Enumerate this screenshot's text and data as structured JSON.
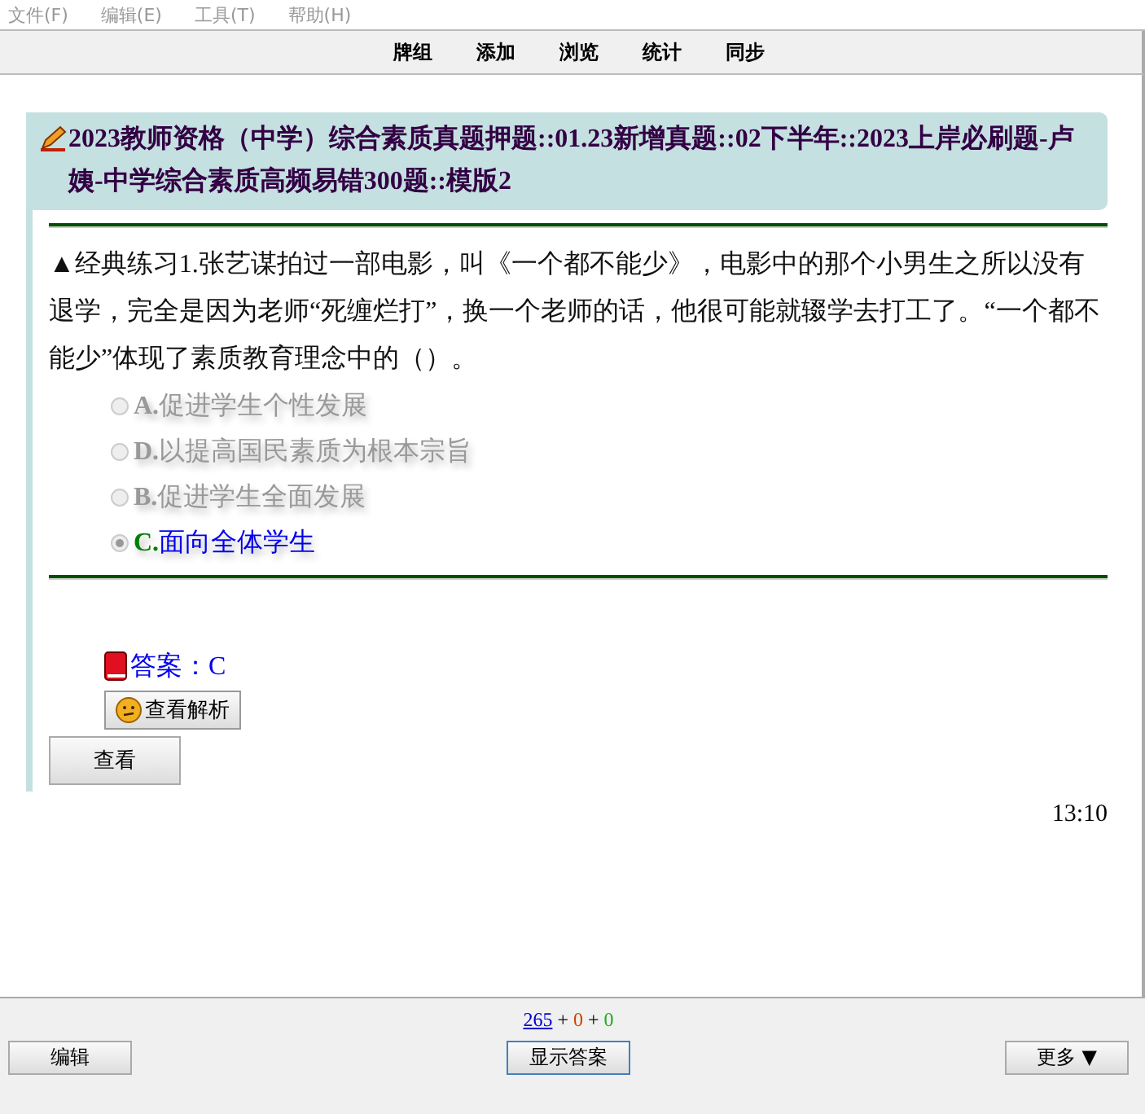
{
  "menu": [
    "文件(F)",
    "编辑(E)",
    "工具(T)",
    "帮助(H)"
  ],
  "toolbar": [
    "牌组",
    "添加",
    "浏览",
    "统计",
    "同步"
  ],
  "card": {
    "title": "2023教师资格（中学）综合素质真题押题::01.23新增真题::02下半年::2023上岸必刷题-卢姨-中学综合素质高频易错300题::模版2",
    "question": "▲经典练习1.张艺谋拍过一部电影，叫《一个都不能少》，电影中的那个小男生之所以没有退学，完全是因为老师“死缠烂打”，换一个老师的话，他很可能就辍学去打工了。“一个都不能少”体现了素质教育理念中的（）。",
    "options": [
      {
        "letter": "A.",
        "text": "促进学生个性发展",
        "selected": false
      },
      {
        "letter": "D.",
        "text": "以提高国民素质为根本宗旨",
        "selected": false
      },
      {
        "letter": "B.",
        "text": "促进学生全面发展",
        "selected": false
      },
      {
        "letter": "C.",
        "text": "面向全体学生",
        "selected": true
      }
    ],
    "answer": "答案：C",
    "analysis_button": "查看解析",
    "view_button": "查看",
    "time": "13:10"
  },
  "counts": [
    {
      "value": "265",
      "color": "#0000cc"
    },
    {
      "value": "0",
      "color": "#cc4400"
    },
    {
      "value": "0",
      "color": "#22aa22"
    }
  ],
  "count_separator": "+",
  "buttons": {
    "edit": "编辑",
    "show_answer": "显示答案",
    "more": "更多 ▼"
  }
}
